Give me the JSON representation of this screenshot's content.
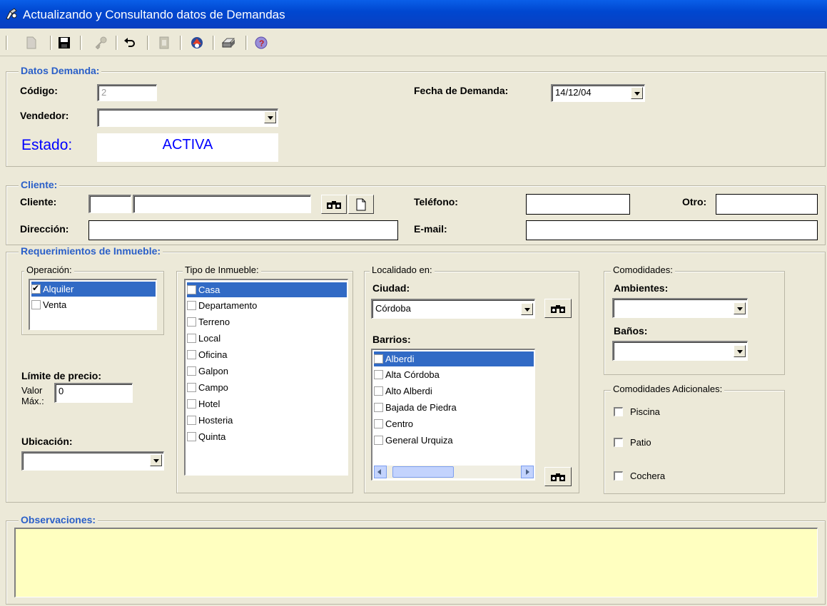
{
  "window": {
    "title": "Actualizando y Consultando datos de Demandas"
  },
  "toolbar": {
    "buttons": [
      "new-document-icon",
      "save-icon",
      "key-icon",
      "undo-icon",
      "copy-icon",
      "paint-icon",
      "print-icon",
      "help-icon"
    ]
  },
  "datos_demanda": {
    "title": "Datos Demanda:",
    "codigo_label": "Código:",
    "codigo_value": "2",
    "fecha_label": "Fecha de Demanda:",
    "fecha_value": "14/12/04",
    "vendedor_label": "Vendedor:",
    "vendedor_value": "",
    "estado_label": "Estado:",
    "estado_value": "ACTIVA"
  },
  "cliente": {
    "title": "Cliente:",
    "cliente_label": "Cliente:",
    "cliente_code": "",
    "cliente_name": "",
    "telefono_label": "Teléfono:",
    "telefono_value": "",
    "otro_label": "Otro:",
    "otro_value": "",
    "direccion_label": "Dirección:",
    "direccion_value": "",
    "email_label": "E-mail:",
    "email_value": ""
  },
  "requerimientos": {
    "title": "Requerimientos de Inmueble:",
    "operacion": {
      "title": "Operación:",
      "items": [
        {
          "label": "Alquiler",
          "checked": true,
          "selected": true
        },
        {
          "label": "Venta",
          "checked": false,
          "selected": false
        }
      ]
    },
    "limite_label": "Límite de precio:",
    "valor_label_1": "Valor",
    "valor_label_2": "Máx.:",
    "valor_value": "0",
    "ubicacion_label": "Ubicación:",
    "ubicacion_value": "",
    "tipo": {
      "title": "Tipo de Inmueble:",
      "items": [
        "Casa",
        "Departamento",
        "Terreno",
        "Local",
        "Oficina",
        "Galpon",
        "Campo",
        "Hotel",
        "Hosteria",
        "Quinta"
      ]
    },
    "localidad": {
      "title": "Localidado en:",
      "ciudad_label": "Ciudad:",
      "ciudad_value": "Córdoba",
      "barrios_label": "Barrios:",
      "barrios": [
        "Alberdi",
        "Alta Córdoba",
        "Alto Alberdi",
        "Bajada de Piedra",
        "Centro",
        "General Urquiza"
      ]
    },
    "comodidades": {
      "title": "Comodidades:",
      "ambientes_label": "Ambientes:",
      "ambientes_value": "",
      "banos_label": "Baños:",
      "banos_value": ""
    },
    "adicionales": {
      "title": "Comodidades Adicionales:",
      "items": [
        "Piscina",
        "Patio",
        "Cochera"
      ]
    }
  },
  "observaciones": {
    "title": "Observaciones:",
    "value": ""
  },
  "colors": {
    "titlebar": "#0047d0",
    "accent": "#2a5fc8",
    "selection": "#316ac5",
    "notes_bg": "#ffffc0",
    "estado_text": "#0000ff"
  }
}
